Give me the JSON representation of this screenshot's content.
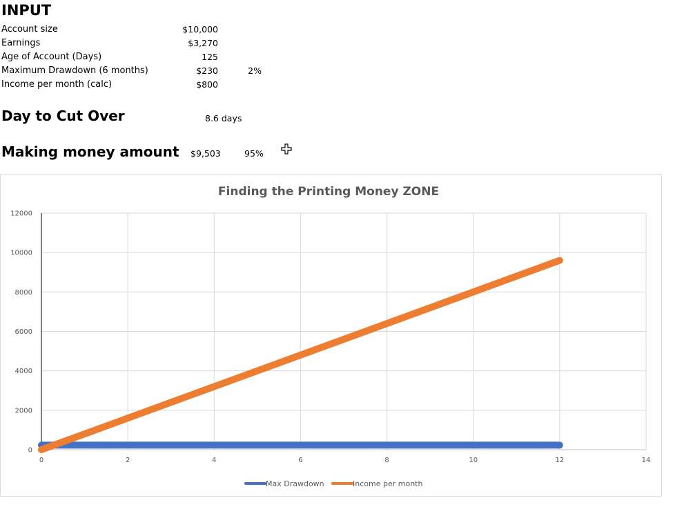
{
  "input_section": {
    "heading": "INPUT",
    "rows": [
      {
        "label": "Account size",
        "value": "$10,000",
        "extra": ""
      },
      {
        "label": "Earnings",
        "value": "$3,270",
        "extra": ""
      },
      {
        "label": "Age of Account (Days)",
        "value": "125",
        "extra": ""
      },
      {
        "label": "Maximum Drawdown (6 months)",
        "value": "$230",
        "extra": "2%"
      },
      {
        "label": "Income per month (calc)",
        "value": "$800",
        "extra": ""
      }
    ]
  },
  "cut_over": {
    "label": "Day to Cut Over",
    "value": "8.6 days"
  },
  "making_money": {
    "label": "Making money amount",
    "value": "$9,503",
    "percent": "95%"
  },
  "cursor_icon": "move-cursor-icon",
  "colors": {
    "max_drawdown": "#4472c4",
    "income": "#ed7d31",
    "grid": "#d9d9d9",
    "axis_text": "#595959"
  },
  "chart_data": {
    "type": "line",
    "title": "Finding the Printing Money ZONE",
    "xlabel": "",
    "ylabel": "",
    "xlim": [
      0,
      14
    ],
    "ylim": [
      0,
      12000
    ],
    "x_ticks": [
      0,
      2,
      4,
      6,
      8,
      10,
      12,
      14
    ],
    "y_ticks": [
      0,
      2000,
      4000,
      6000,
      8000,
      10000,
      12000
    ],
    "grid": true,
    "legend_position": "bottom",
    "series": [
      {
        "name": "Max Drawdown",
        "x": [
          0,
          12
        ],
        "y": [
          230,
          230
        ],
        "color": "#4472c4"
      },
      {
        "name": "Income per month",
        "x": [
          0,
          12
        ],
        "y": [
          0,
          9600
        ],
        "color": "#ed7d31"
      }
    ]
  }
}
